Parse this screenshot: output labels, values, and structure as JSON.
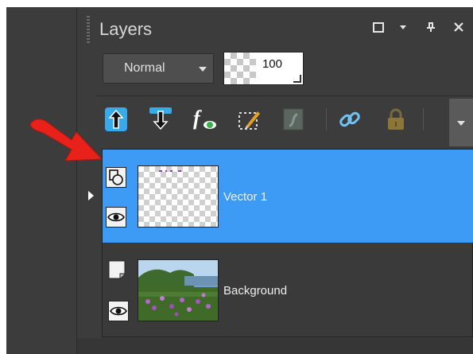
{
  "panel": {
    "title": "Layers",
    "window_controls": [
      "□",
      "▾",
      "⊥",
      "✕"
    ]
  },
  "blend_mode": {
    "value": "Normal"
  },
  "opacity": {
    "value": "100"
  },
  "toolbar": {
    "icons": [
      "move-layer-up-icon",
      "move-layer-down-icon",
      "layer-styles-icon",
      "edit-mask-icon",
      "vector-path-icon",
      "link-icon",
      "lock-icon",
      "more-options-icon"
    ]
  },
  "layers": [
    {
      "name": "Vector 1",
      "selected": true,
      "type": "vector",
      "visible": true
    },
    {
      "name": "Background",
      "selected": false,
      "type": "raster",
      "visible": true
    }
  ],
  "colors": {
    "selection": "#3d9bf5",
    "panel_bg": "#3c3c3c",
    "arrow_annotation": "#e8221b"
  }
}
